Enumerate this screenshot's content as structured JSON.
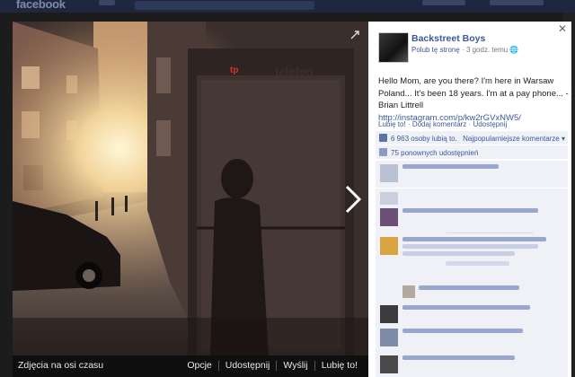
{
  "topbar": {
    "logo": "facebook"
  },
  "photo_bar": {
    "album": "Zdjęcia na osi czasu",
    "actions": [
      "Opcje",
      "Udostępnij",
      "Wyślij",
      "Lubię to!"
    ]
  },
  "sign": {
    "brand": "tp",
    "word": "telefon"
  },
  "post": {
    "page_name": "Backstreet Boys",
    "like_page": "Polub tę stronę",
    "time": "3 godz. temu",
    "text": "Hello Mom, are you there? I'm here in Warsaw Poland... It's been 18 years. I'm at a pay phone... - Brian Littrell",
    "link": "http://instagram.com/p/kw2rGVxNW5/",
    "actions": [
      "Lubię to!",
      "Dodaj komentarz",
      "Udostępnij"
    ]
  },
  "stats": {
    "likes": "6 963 osoby lubią to.",
    "sort": "Najpopularniejsze komentarze ▾",
    "shares": "75 ponownych udostępnień"
  },
  "icons": {
    "close": "close-icon",
    "next": "chevron-right-icon",
    "expand": "expand-icon",
    "globe": "globe-icon",
    "like": "thumbs-up-icon",
    "share": "share-icon"
  },
  "colors": {
    "link": "#3b5998",
    "panel_bg": "#eff1f7",
    "photo_bar": "#0f0f0f"
  }
}
